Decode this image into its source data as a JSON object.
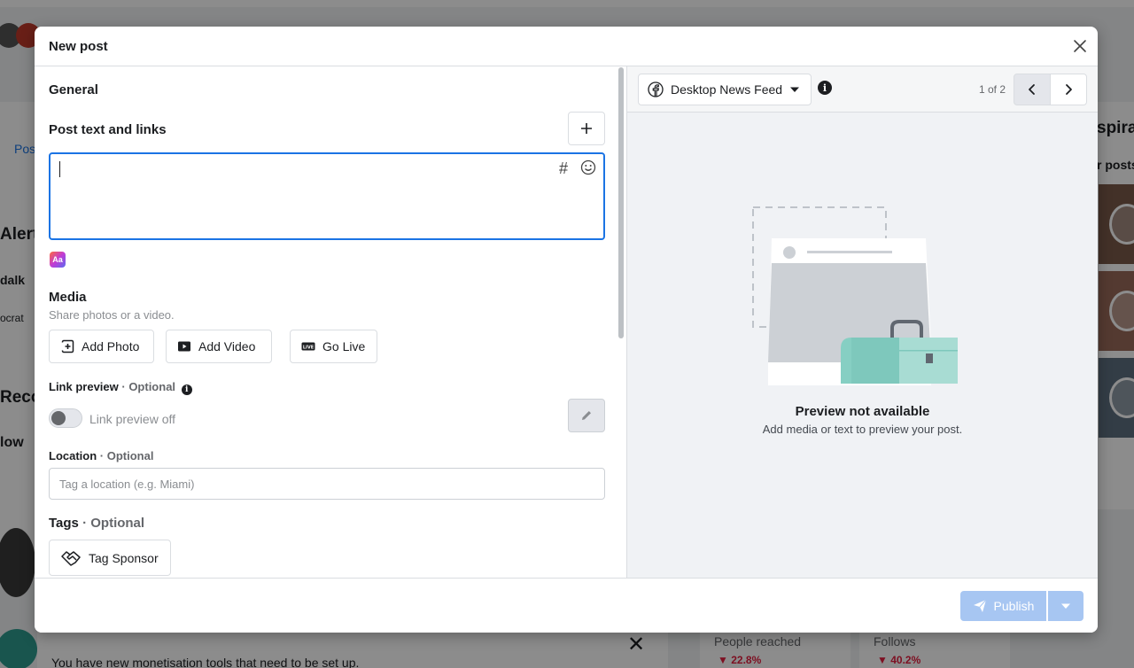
{
  "background": {
    "left_heading_1": "Alert",
    "left_heading_2": "Reco",
    "left_brand_1": "dalk",
    "left_brand_2": "ocrat",
    "left_brand_3": "low",
    "tab_label": "Pos",
    "right_heading": "spira",
    "right_sub": "r posts",
    "notice_text": "You have new monetisation tools that need to be set up.",
    "stats": [
      {
        "label": "People reached",
        "value": "22.8%"
      },
      {
        "label": "Follows",
        "value": "40.2%"
      }
    ]
  },
  "modal": {
    "title": "New post",
    "general_heading": "General",
    "post_text": {
      "heading": "Post text and links",
      "value": "",
      "hashtag_symbol": "#",
      "ai_badge": "Aa"
    },
    "media": {
      "heading": "Media",
      "subtitle": "Share photos or a video.",
      "buttons": [
        "Add Photo",
        "Add Video",
        "Go Live"
      ]
    },
    "link_preview": {
      "label": "Link preview",
      "optional": "· Optional",
      "info": "i",
      "toggle_label": "Link preview off",
      "enabled": false
    },
    "location": {
      "label": "Location",
      "optional": "· Optional",
      "placeholder": "Tag a location (e.g. Miami)",
      "value": ""
    },
    "tags": {
      "label": "Tags",
      "optional": "· Optional",
      "button": "Tag Sponsor"
    },
    "preview": {
      "placement": "Desktop News Feed",
      "info": "i",
      "pager": "1 of 2",
      "title": "Preview not available",
      "subtitle": "Add media or text to preview your post."
    },
    "footer": {
      "publish_label": "Publish"
    }
  },
  "colors": {
    "accent": "#1b74e4",
    "publish_disabled": "#a7c6f2",
    "negative": "#e41e3f"
  }
}
